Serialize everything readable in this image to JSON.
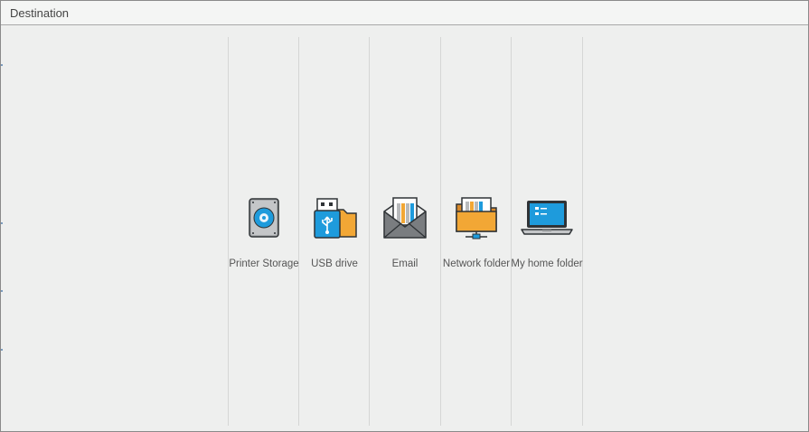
{
  "header": {
    "title": "Destination"
  },
  "destinations": [
    {
      "label": "Printer Storage",
      "icon": "hard-drive-icon"
    },
    {
      "label": "USB drive",
      "icon": "usb-drive-icon"
    },
    {
      "label": "Email",
      "icon": "email-envelope-icon"
    },
    {
      "label": "Network folder",
      "icon": "network-folder-icon"
    },
    {
      "label": "My home folder",
      "icon": "laptop-home-folder-icon"
    }
  ],
  "colors": {
    "accent_blue": "#1e9bdc",
    "folder_orange": "#f2a735",
    "icon_outline": "#2f3336",
    "background": "#eeefee"
  }
}
